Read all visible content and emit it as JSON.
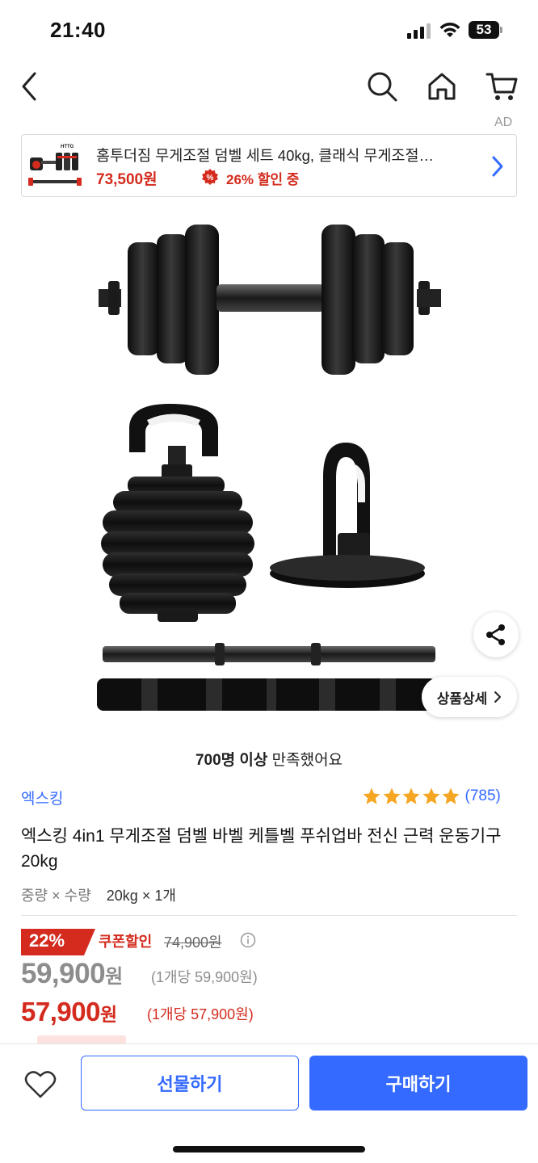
{
  "status_bar": {
    "time": "21:40",
    "battery": "53"
  },
  "nav": {
    "icons": [
      "back-icon",
      "search-icon",
      "home-icon",
      "cart-icon"
    ]
  },
  "ad": {
    "label": "AD",
    "title": "홈투더짐 무게조절 덤벨 세트 40kg, 클래식 무게조절…",
    "price": "73,500원",
    "discount": "26% 할인 중",
    "thumb_brand": "HTTG"
  },
  "image_overlay": {
    "detail_label": "상품상세"
  },
  "satisfaction": {
    "bold": "700명 이상",
    "rest": " 만족했어요"
  },
  "product": {
    "brand": "엑스킹",
    "rating_count": "(785)",
    "rating_stars": 5,
    "title": "엑스킹 4in1 무게조절 덤벨 바벨 케틀벨 푸쉬업바 전신 근력 운동기구 20kg",
    "option_label": "중량 × 수량",
    "option_value": "20kg × 1개"
  },
  "pricing": {
    "discount_rate": "22%",
    "coupon_label": "쿠폰할인",
    "original_price": "74,900원",
    "sale_price": "59,900",
    "sale_price_unit": "원",
    "sale_price_per": "(1개당 59,900원)",
    "coupon_price": "57,900",
    "coupon_price_unit": "원",
    "coupon_price_per": "(1개당 57,900원)"
  },
  "bottom": {
    "gift_label": "선물하기",
    "buy_label": "구매하기"
  },
  "colors": {
    "accent_blue": "#346aff",
    "sale_red": "#d42b1e",
    "muted_gray": "#8d8d8d"
  }
}
